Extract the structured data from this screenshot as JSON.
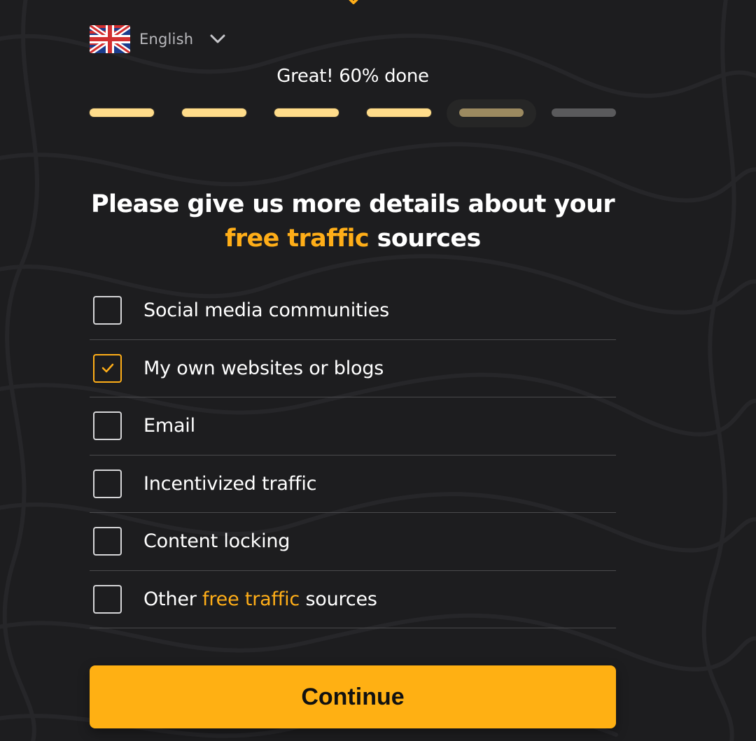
{
  "language": {
    "selected": "English",
    "flag_icon": "uk-flag-icon",
    "dropdown_icon": "chevron-down-icon"
  },
  "progress": {
    "text": "Great! 60% done",
    "percent": 60,
    "total_steps": 6,
    "completed_steps": 4,
    "current_step": 5
  },
  "heading": {
    "line1": "Please give us more details about your",
    "accent": "free traffic",
    "line2_rest": " sources"
  },
  "options": [
    {
      "label": "Social media communities",
      "checked": false
    },
    {
      "label": "My own websites or blogs",
      "checked": true
    },
    {
      "label": "Email",
      "checked": false
    },
    {
      "label": "Incentivized traffic",
      "checked": false
    },
    {
      "label": "Content locking",
      "checked": false
    },
    {
      "label_prefix": "Other ",
      "label_accent": "free traffic",
      "label_suffix": " sources",
      "checked": false
    }
  ],
  "continue_label": "Continue",
  "colors": {
    "background": "#1d1d1f",
    "accent": "#ffae18",
    "button": "#ffb013",
    "progress_done": "#ffdc8a",
    "progress_current": "#9c8a60",
    "progress_todo": "#5a5a5c",
    "divider": "#4a4a4c"
  }
}
